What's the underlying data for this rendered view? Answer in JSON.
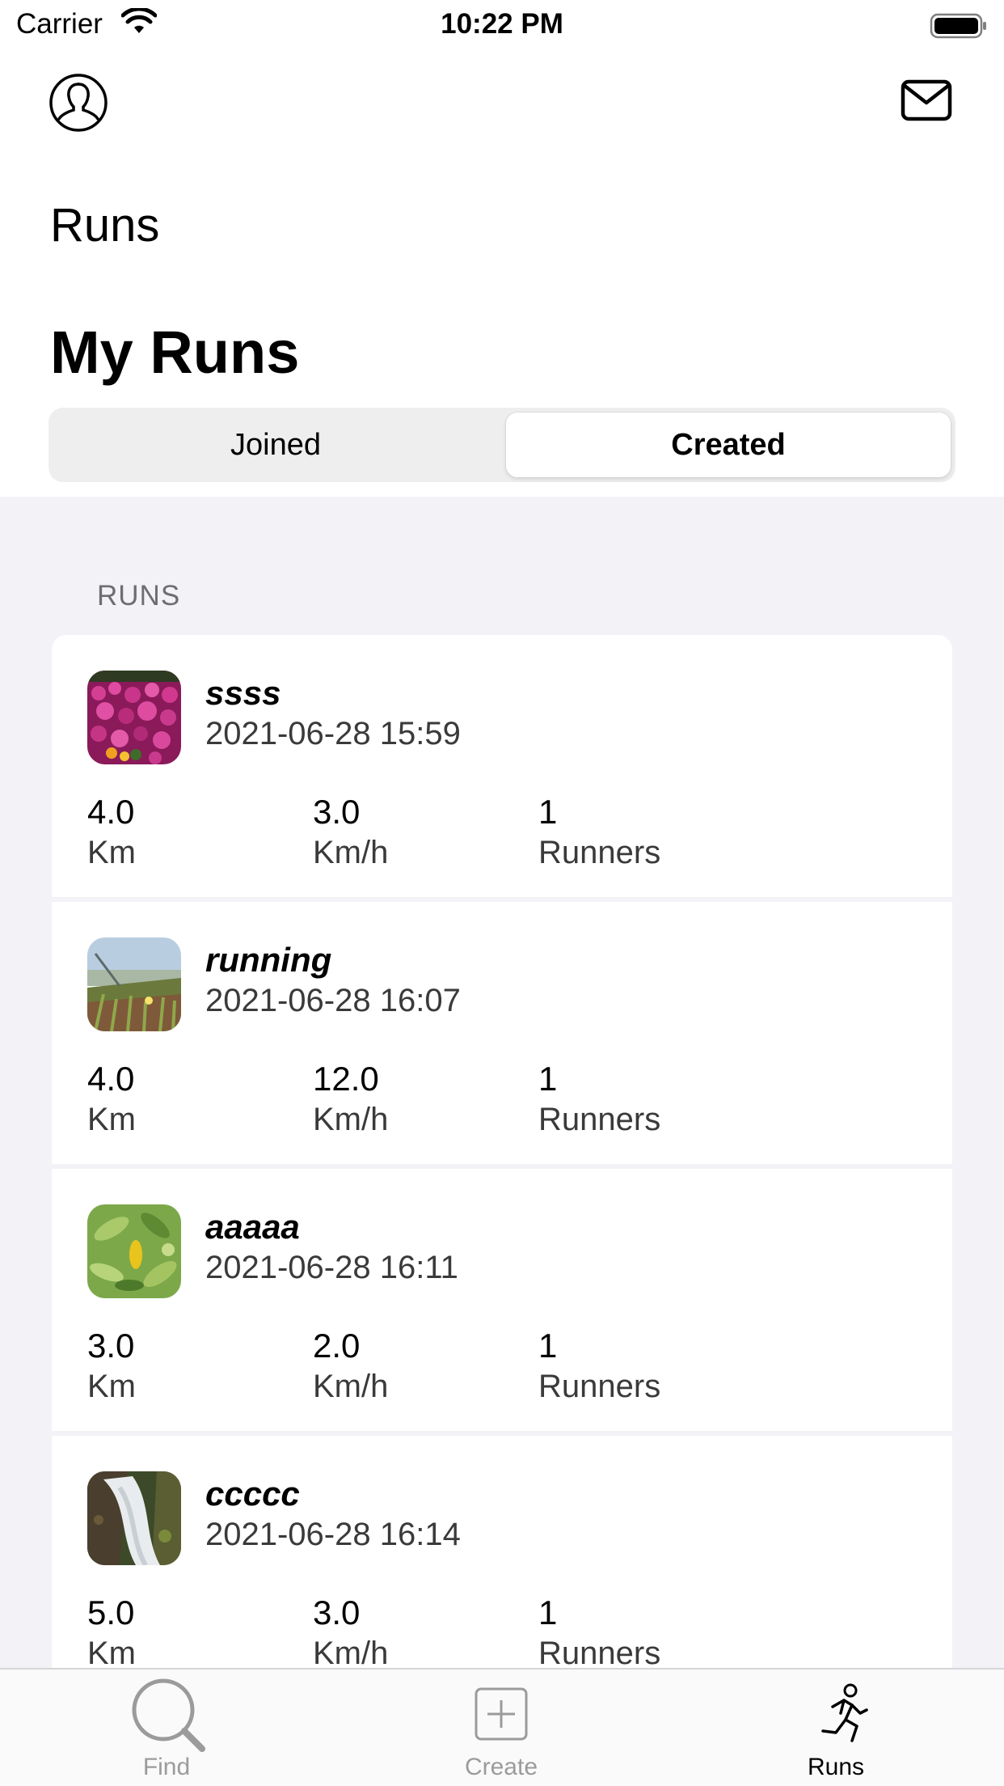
{
  "status_bar": {
    "carrier": "Carrier",
    "time": "10:22 PM"
  },
  "header": {
    "profile_icon": "person-circle-icon",
    "messages_icon": "envelope-icon",
    "nav_title": "Runs",
    "large_title": "My Runs"
  },
  "segmented_control": {
    "segments": [
      {
        "label": "Joined",
        "selected": false
      },
      {
        "label": "Created",
        "selected": true
      }
    ]
  },
  "runs_section": {
    "header": "RUNS",
    "items": [
      {
        "name": "ssss",
        "date": "2021-06-28 15:59",
        "distance": "4.0",
        "distance_unit": "Km",
        "speed": "3.0",
        "speed_unit": "Km/h",
        "runners": "1",
        "runners_label": "Runners",
        "thumbnail": "flowers-photo"
      },
      {
        "name": "running",
        "date": "2021-06-28 16:07",
        "distance": "4.0",
        "distance_unit": "Km",
        "speed": "12.0",
        "speed_unit": "Km/h",
        "runners": "1",
        "runners_label": "Runners",
        "thumbnail": "coastal-field-photo"
      },
      {
        "name": "aaaaa",
        "date": "2021-06-28 16:11",
        "distance": "3.0",
        "distance_unit": "Km",
        "speed": "2.0",
        "speed_unit": "Km/h",
        "runners": "1",
        "runners_label": "Runners",
        "thumbnail": "green-leaves-photo"
      },
      {
        "name": "ccccc",
        "date": "2021-06-28 16:14",
        "distance": "5.0",
        "distance_unit": "Km",
        "speed": "3.0",
        "speed_unit": "Km/h",
        "runners": "1",
        "runners_label": "Runners",
        "thumbnail": "waterfall-photo"
      }
    ]
  },
  "tab_bar": {
    "tabs": [
      {
        "label": "Find",
        "icon": "magnifying-glass-icon",
        "active": false
      },
      {
        "label": "Create",
        "icon": "plus-square-icon",
        "active": false
      },
      {
        "label": "Runs",
        "icon": "running-figure-icon",
        "active": true
      }
    ]
  },
  "colors": {
    "list_background": "#f2f2f7",
    "card_background": "#ffffff",
    "inactive_tab": "#9b9b9b",
    "secondary_text": "#3a3a3c"
  }
}
